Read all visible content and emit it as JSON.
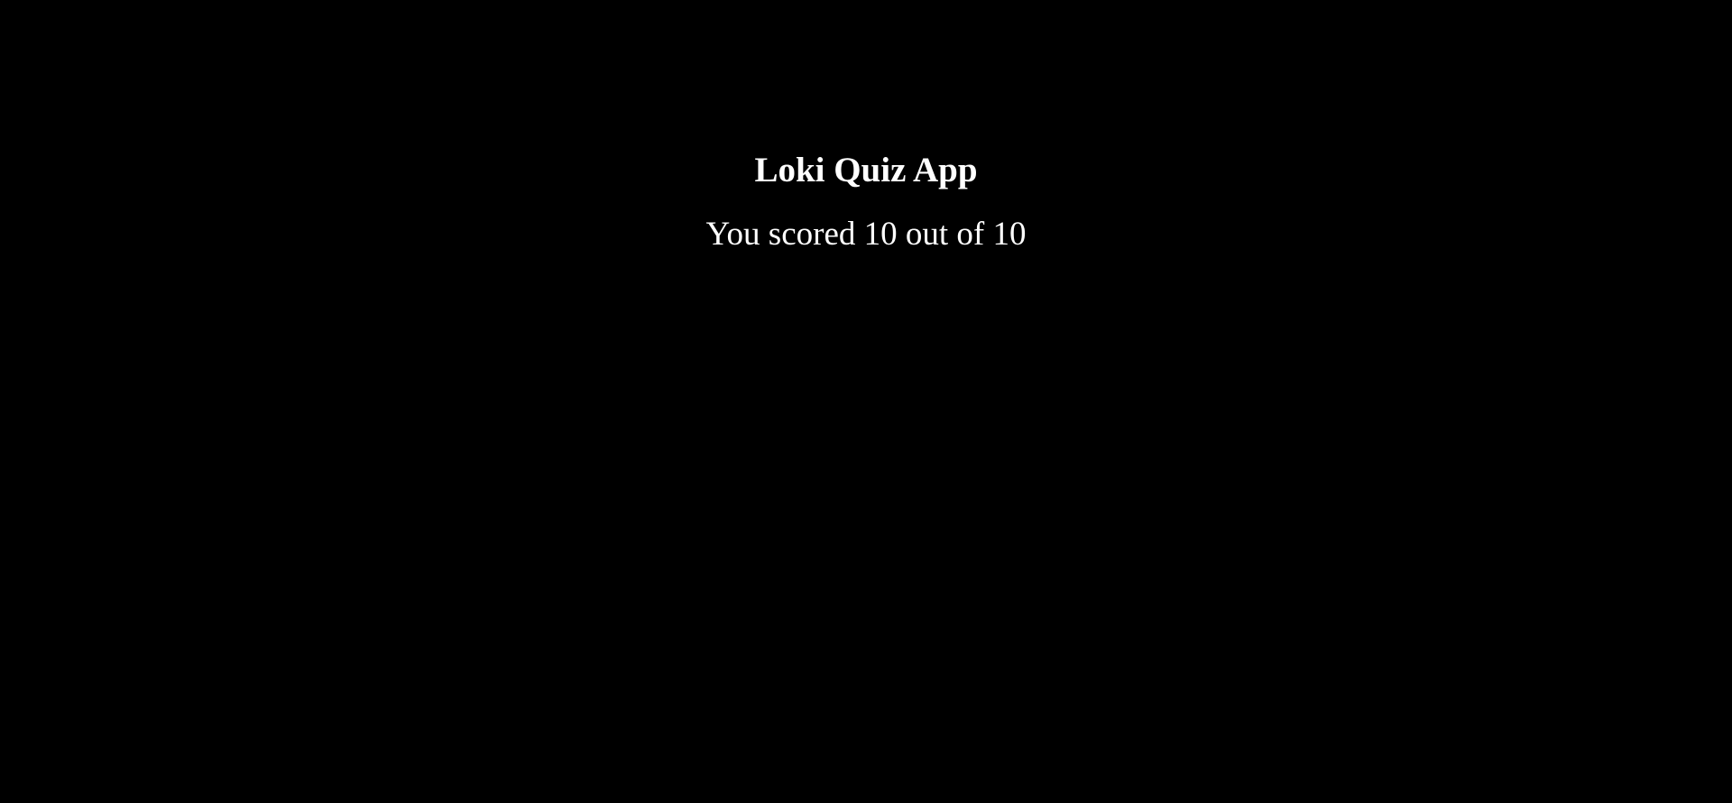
{
  "app": {
    "title": "Loki Quiz App"
  },
  "result": {
    "text": "You scored 10 out of 10",
    "score": 10,
    "total": 10
  },
  "colors": {
    "background": "#000000",
    "text": "#ffffff"
  }
}
